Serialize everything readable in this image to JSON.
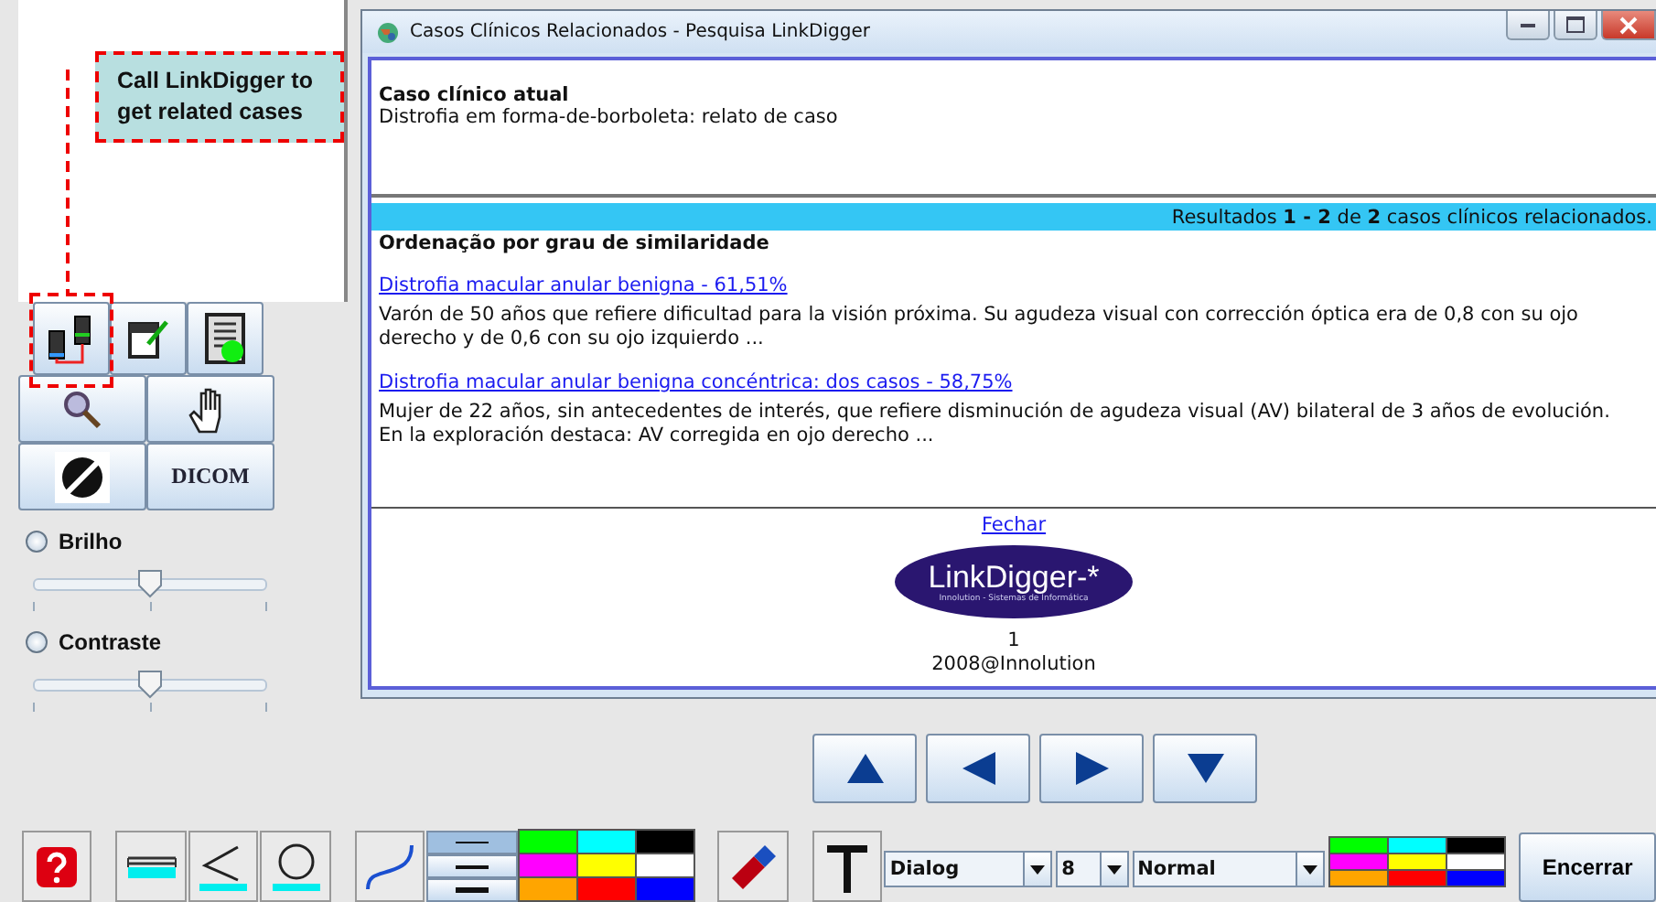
{
  "annotation": {
    "text": "Call LinkDigger to get related cases"
  },
  "dicom_label": "DICOM",
  "adjustments": [
    {
      "label": "Brilho",
      "selected": false,
      "level": 0.5
    },
    {
      "label": "Contraste",
      "selected": false,
      "level": 0.5
    }
  ],
  "window": {
    "title": "Casos Clínicos Relacionados - Pesquisa LinkDigger",
    "current_case_heading": "Caso clínico atual",
    "current_case": "Distrofia em forma-de-borboleta: relato de caso",
    "results_bar": "Resultados **1 - 2** de **2** casos clínicos relacionados.",
    "ordering_heading": "Ordenação por grau de similaridade",
    "results": [
      {
        "link": "Distrofia macular anular benigna - 61,51%",
        "summary": "Varón de 50 años que refiere dificultad para la visión próxima. Su agudeza visual con corrección óptica era de 0,8 con su ojo derecho y de 0,6 con su ojo izquierdo ..."
      },
      {
        "link": "Distrofia macular anular benigna concéntrica: dos casos - 58,75%",
        "summary": "Mujer de 22 años, sin antecedentes de interés, que refiere disminución de agudeza visual (AV) bilateral de 3 años de evolución. En la exploración destaca: AV corregida en ojo derecho ..."
      }
    ],
    "close_link": "Fechar",
    "logo": {
      "text": "LinkDigger-*",
      "subtitle": "Innolution - Sistemas de Informática"
    },
    "page": "1",
    "copyright": "2008@Innolution"
  },
  "line_widths": [
    {
      "selected": true
    },
    {
      "selected": false
    },
    {
      "selected": false
    }
  ],
  "palette": [
    {
      "color": "#00ff00"
    },
    {
      "color": "#00ffff"
    },
    {
      "color": "#000000"
    },
    {
      "color": "#ff00ff"
    },
    {
      "color": "#ffff00"
    },
    {
      "color": "#ffffff"
    },
    {
      "color": "#ffa500"
    },
    {
      "color": "#ff0000"
    },
    {
      "color": "#0000ff"
    }
  ],
  "text_tools": {
    "font": "Dialog",
    "size": "8",
    "style": "Normal"
  },
  "text_palette": [
    {
      "color": "#00ff00"
    },
    {
      "color": "#00ffff"
    },
    {
      "color": "#000000"
    },
    {
      "color": "#ff00ff"
    },
    {
      "color": "#ffff00"
    },
    {
      "color": "#ffffff"
    },
    {
      "color": "#ffa500"
    },
    {
      "color": "#ff0000"
    },
    {
      "color": "#0000ff"
    }
  ],
  "finish_button": "Encerrar"
}
